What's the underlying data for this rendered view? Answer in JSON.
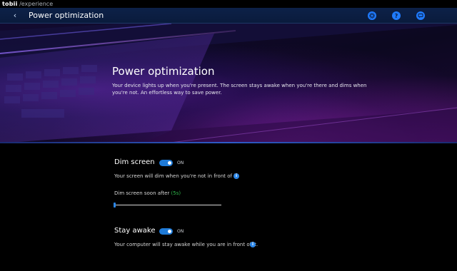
{
  "window": {
    "brand": "tobii",
    "product": "/experience"
  },
  "appbar": {
    "back_glyph": "‹",
    "title": "Power optimization"
  },
  "hero": {
    "title": "Power optimization",
    "description": "Your device lights up when you're present. The screen stays awake when you're there and dims when you're not. An effortless way to save power."
  },
  "dim_screen": {
    "label": "Dim screen",
    "toggle_state": "ON",
    "help_text": "Your screen will dim when you're not in front of it.",
    "info_glyph": "i",
    "slider_label": "Dim screen soon after",
    "slider_value": "(5s)",
    "slider_level": 0
  },
  "stay_awake": {
    "label": "Stay awake",
    "toggle_state": "ON",
    "help_text": "Your computer will stay awake while you are in front of it.",
    "info_glyph": "i"
  },
  "colors": {
    "accent": "#1f7bd8",
    "appbar": "#0d2148",
    "slider_value": "#2fb84a"
  },
  "icons": [
    "settings-icon",
    "help-icon",
    "feedback-icon",
    "info-icon",
    "back-icon"
  ]
}
